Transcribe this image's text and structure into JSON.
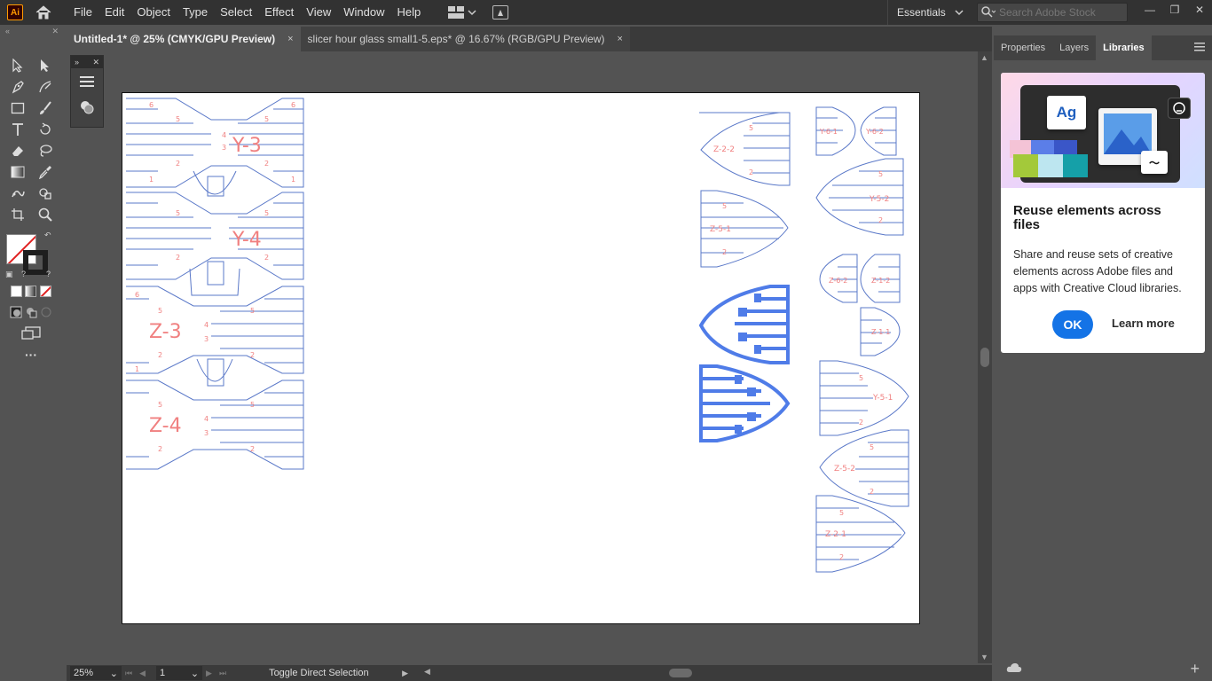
{
  "app": {
    "logo": "Ai"
  },
  "menu": [
    "File",
    "Edit",
    "Object",
    "Type",
    "Select",
    "Effect",
    "View",
    "Window",
    "Help"
  ],
  "workspace": {
    "label": "Essentials"
  },
  "search": {
    "placeholder": "Search Adobe Stock"
  },
  "tabs": [
    {
      "label": "Untitled-1* @ 25% (CMYK/GPU Preview)",
      "close": "×"
    },
    {
      "label": "slicer hour glass small1-5.eps* @ 16.67% (RGB/GPU Preview)",
      "close": "×"
    }
  ],
  "status": {
    "zoom": "25%",
    "page": "1",
    "text": "Toggle Direct Selection"
  },
  "panel_tabs": [
    "Properties",
    "Layers",
    "Libraries"
  ],
  "library_card": {
    "badge": "Ag",
    "title": "Reuse elements across files",
    "body": "Share and reuse sets of creative elements across Adobe files and apps with Creative Cloud libraries.",
    "ok": "OK",
    "learn_more": "Learn more"
  },
  "artwork_labels": {
    "y3": "Y-3",
    "y4": "Y-4",
    "z3": "Z-3",
    "z4": "Z-4",
    "z22": "Z-2-2",
    "z51": "Z-5-1",
    "y61": "Y-6-1",
    "y62": "Y-6-2",
    "y52": "Y-5-2",
    "z62": "Z-6-2",
    "z12": "Z-1-2",
    "z11": "Z-1-1",
    "y51": "Y-5-1",
    "z52": "Z-5-2",
    "z21": "Z-2-1",
    "n1": "1",
    "n2": "2",
    "n3": "3",
    "n4": "4",
    "n5": "5",
    "n6": "6"
  },
  "colors": {
    "accent": "#1473e6",
    "art_stroke": "#5a78c8",
    "art_text": "#f08080",
    "art_fill": "#4f7ce8"
  }
}
